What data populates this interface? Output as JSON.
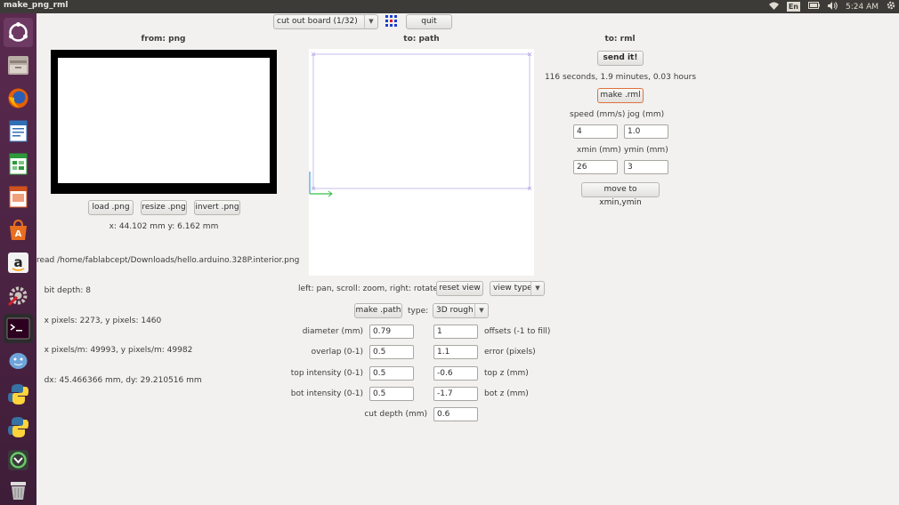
{
  "window": {
    "title": "make_png_rml"
  },
  "tray": {
    "lang": "En",
    "time": "5:24 AM"
  },
  "launcher": {
    "items": [
      "ubuntu-dash-icon",
      "files-icon",
      "firefox-icon",
      "writer-icon",
      "calc-icon",
      "impress-icon",
      "software-center-icon",
      "amazon-icon",
      "settings-icon",
      "terminal-icon",
      "pidgin-icon",
      "python-icon",
      "python-icon",
      "backup-icon",
      "trash-icon"
    ]
  },
  "toolbar": {
    "process_select": "cut out board (1/32)",
    "quit_label": "quit"
  },
  "png_panel": {
    "header": "from: png",
    "load_label": "load .png",
    "resize_label": "resize .png",
    "invert_label": "invert .png",
    "coords": "x: 44.102 mm  y: 6.162 mm",
    "info": [
      "read /home/fablabcept/Downloads/hello.arduino.328P.interior.png",
      "   bit depth: 8",
      "   x pixels: 2273, y pixels: 1460",
      "   x pixels/m: 49993, y pixels/m: 49982",
      "   dx: 45.466366 mm, dy: 29.210516 mm"
    ]
  },
  "path_panel": {
    "header": "to: path",
    "view_help": "left: pan, scroll: zoom, right: rotate",
    "reset_view_label": "reset view",
    "view_type_select": "view type",
    "make_path_label": "make .path",
    "type_label": "type:",
    "type_select": "3D rough",
    "diameter_label": "diameter (mm)",
    "diameter_value": "0.79",
    "offsets_value": "1",
    "offsets_label": "offsets (-1 to fill)",
    "overlap_label": "overlap (0-1)",
    "overlap_value": "0.5",
    "error_value": "1.1",
    "error_label": "error (pixels)",
    "top_intensity_label": "top intensity (0-1)",
    "top_intensity_value": "0.5",
    "top_z_value": "-0.6",
    "top_z_label": "top z (mm)",
    "bot_intensity_label": "bot intensity (0-1)",
    "bot_intensity_value": "0.5",
    "bot_z_value": "-1.7",
    "bot_z_label": "bot z (mm)",
    "cut_depth_label": "cut depth (mm)",
    "cut_depth_value": "0.6"
  },
  "rml_panel": {
    "header": "to: rml",
    "send_label": "send it!",
    "time_estimate": "116 seconds, 1.9 minutes, 0.03 hours",
    "make_rml_label": "make .rml",
    "speed_label": "speed (mm/s)",
    "jog_label": "jog (mm)",
    "speed_value": "4",
    "jog_value": "1.0",
    "xmin_label": "xmin (mm)",
    "ymin_label": "ymin (mm)",
    "xmin_value": "26",
    "ymin_value": "3",
    "move_label": "move to xmin,ymin"
  },
  "colors": {
    "launcher_bg": "#4b2242",
    "topbar_bg": "#3c3b37",
    "window_bg": "#f2f1f0",
    "accent_orange": "#e0713c"
  }
}
